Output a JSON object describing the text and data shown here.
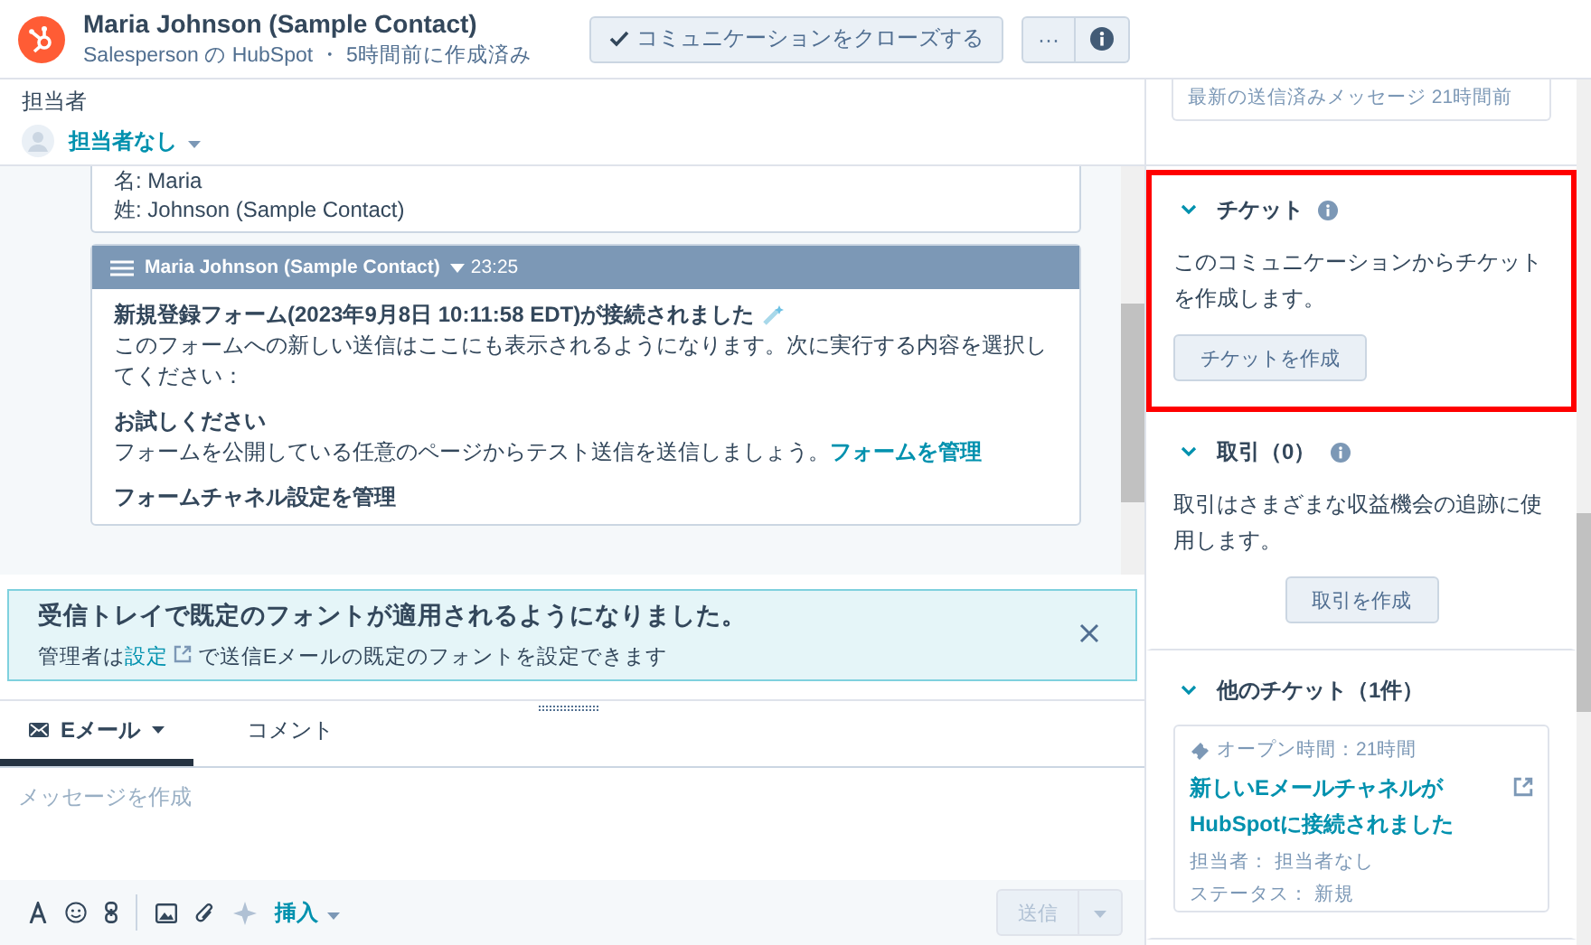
{
  "header": {
    "title": "Maria Johnson (Sample Contact)",
    "subtitle": "Salesperson の HubSpot ・ 5時間前に作成済み",
    "close_button": "コミュニケーションをクローズする",
    "more_button": "···"
  },
  "assignee": {
    "label": "担当者",
    "value": "担当者なし"
  },
  "conversation": {
    "form_lines": [
      "名: Maria",
      "姓: Johnson (Sample Contact)"
    ],
    "message": {
      "sender": "Maria Johnson (Sample Contact)",
      "time": "23:25",
      "title": "新規登録フォーム(2023年9月8日 10:11:58 EDT)が接続されました",
      "body": "このフォームへの新しい送信はここにも表示されるようになります。次に実行する内容を選択してください：",
      "sections": [
        {
          "heading": "お試しください",
          "text": "フォームを公開している任意のページからテスト送信を送信しましょう。",
          "link": "フォームを管理"
        },
        {
          "heading": "フォームチャネル設定を管理"
        }
      ]
    }
  },
  "banner": {
    "title": "受信トレイで既定のフォントが適用されるようになりました。",
    "text_before": "管理者は",
    "link": "設定",
    "text_after": "で送信Eメールの既定のフォントを設定できます"
  },
  "composer": {
    "tabs": [
      {
        "label": "Eメール",
        "selected": true
      },
      {
        "label": "コメント",
        "selected": false
      }
    ],
    "placeholder": "メッセージを作成",
    "insert": "挿入",
    "send": "送信"
  },
  "sidebar": {
    "last_message": "最新の送信済みメッセージ 21時間前",
    "sections": [
      {
        "kind": "text",
        "title": "チケット",
        "info": true,
        "expanded": true,
        "highlighted": true,
        "text": "このコミュニケーションからチケットを作成します。",
        "button": "チケットを作成"
      },
      {
        "kind": "text",
        "title": "取引（0）",
        "info": true,
        "expanded": true,
        "highlighted": false,
        "text": "取引はさまざまな収益機会の追跡に使用します。",
        "button": "取引を作成"
      },
      {
        "kind": "card",
        "title": "他のチケット（1件）",
        "info": false,
        "expanded": true,
        "highlighted": false,
        "card": {
          "status": "オープン時間：21時間",
          "title": "新しいEメールチャネルがHubSpotに接続されました",
          "fields": [
            "担当者： 担当者なし",
            "ステータス： 新規"
          ]
        }
      }
    ]
  }
}
